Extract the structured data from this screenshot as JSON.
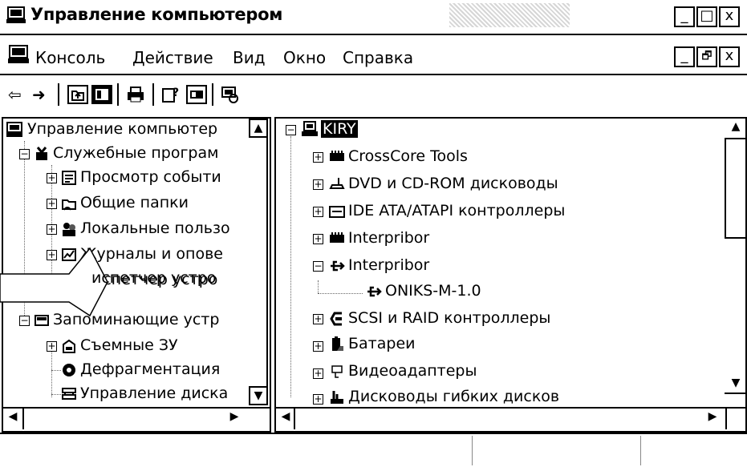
{
  "window": {
    "title": "Управление компьютером",
    "minimize_label": "_",
    "maximize_label": "□",
    "close_label": "x"
  },
  "menu": {
    "items": [
      "Консоль",
      "Действие",
      "Вид",
      "Окно",
      "Справка"
    ],
    "restore_min": "_",
    "restore_max": "🗗",
    "restore_close": "x"
  },
  "toolbar": {
    "back": "⇦",
    "forward": "➜"
  },
  "left_tree": {
    "items": [
      "Управление компьютер",
      "Служебные програм",
      "Просмотр событи",
      "Общие папки",
      "Локальные пользо",
      "Журналы и опове",
      "испетчер устро",
      "Запоминающие устр",
      "Съемные ЗУ",
      "Дефрагментация",
      "Управление диска"
    ]
  },
  "right_tree": {
    "root": "KIRY",
    "items": [
      "CrossCore Tools",
      "DVD и CD-ROM дисководы",
      "IDE ATA/ATAPI контроллеры",
      "Interpribor",
      "Interpribor",
      "ONIKS-M-1.0",
      "SCSI и RAID контроллеры",
      "Батареи",
      "Видеоадаптеры",
      "Дисководы гибких дисков"
    ]
  },
  "scroll": {
    "up": "▲",
    "down": "▼",
    "left": "◀",
    "right": "▶"
  },
  "icons": {
    "computer": "computer-icon",
    "tools": "tools-icon",
    "device": "device-icon"
  }
}
